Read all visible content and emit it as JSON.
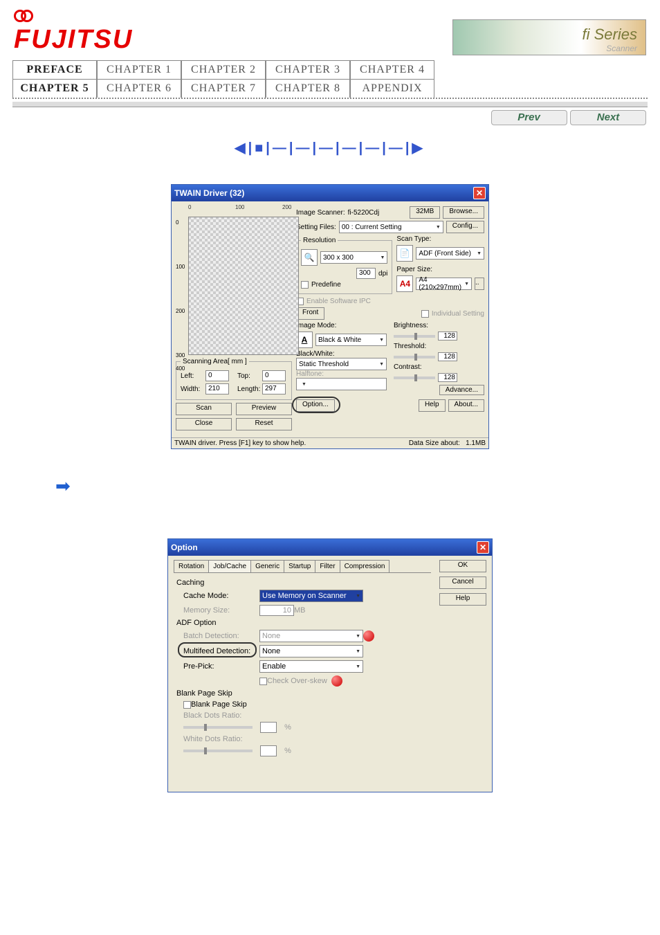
{
  "logo": "FUJITSU",
  "fiseries": "fi Series",
  "fiseries_sub": "Scanner",
  "nav": {
    "tabs": [
      "PREFACE",
      "CHAPTER 1",
      "CHAPTER 2",
      "CHAPTER 3",
      "CHAPTER 4",
      "CHAPTER 5",
      "CHAPTER 6",
      "CHAPTER 7",
      "CHAPTER 8",
      "APPENDIX"
    ]
  },
  "prev": "Prev",
  "next": "Next",
  "twain": {
    "title": "TWAIN Driver (32)",
    "ruler_marks": [
      "0",
      "100",
      "200"
    ],
    "scanning_area_label": "Scanning Area[ mm ]",
    "left_label": "Left:",
    "left_value": "0",
    "top_label": "Top:",
    "top_value": "0",
    "width_label": "Width:",
    "width_value": "210",
    "length_label": "Length:",
    "length_value": "297",
    "scan_btn": "Scan",
    "preview_btn": "Preview",
    "close_btn": "Close",
    "reset_btn": "Reset",
    "image_scanner_label": "Image Scanner:",
    "image_scanner_value": "fi-5220Cdj",
    "mem": "32MB",
    "browse_btn": "Browse...",
    "setting_files_label": "Setting Files:",
    "setting_files_value": "00 : Current Setting",
    "config_btn": "Config...",
    "resolution_label": "Resolution",
    "resolution_value": "300 x 300",
    "custom_res_value": "300",
    "dpi": "dpi",
    "predefine_label": "Predefine",
    "enable_ipc": "Enable Software IPC",
    "front_tab": "Front",
    "individual_setting": "Individual Setting",
    "scan_type_label": "Scan Type:",
    "scan_type_value": "ADF (Front Side)",
    "paper_size_label": "Paper Size:",
    "paper_size_value": "A4 (210x297mm)",
    "image_mode_label": "Image Mode:",
    "image_mode_value": "Black & White",
    "blackwhite_label": "Black/White:",
    "blackwhite_value": "Static Threshold",
    "halftone_label": "Halftone:",
    "brightness_label": "Brightness:",
    "brightness_value": "128",
    "threshold_label": "Threshold:",
    "threshold_value": "128",
    "contrast_label": "Contrast:",
    "contrast_value": "128",
    "advance_btn": "Advance...",
    "option_btn": "Option...",
    "help_btn": "Help",
    "about_btn": "About...",
    "status_left": "TWAIN driver. Press [F1] key to show help.",
    "status_mid": "Data Size about:",
    "status_right": "1.1MB"
  },
  "option": {
    "title": "Option",
    "tabs": [
      "Rotation",
      "Job/Cache",
      "Generic",
      "Startup",
      "Filter",
      "Compression"
    ],
    "ok": "OK",
    "cancel": "Cancel",
    "help": "Help",
    "caching_label": "Caching",
    "cache_mode_label": "Cache Mode:",
    "cache_mode_value": "Use Memory on Scanner",
    "memory_size_label": "Memory Size:",
    "memory_size_value": "10",
    "memory_size_unit": "MB",
    "adf_option_label": "ADF Option",
    "batch_detection_label": "Batch Detection:",
    "batch_detection_value": "None",
    "multifeed_label": "Multifeed Detection:",
    "multifeed_value": "None",
    "prepick_label": "Pre-Pick:",
    "prepick_value": "Enable",
    "check_overskew": "Check Over-skew",
    "blank_page_skip_section": "Blank Page Skip",
    "blank_page_skip_chk": "Blank Page Skip",
    "black_dots_ratio": "Black Dots Ratio:",
    "white_dots_ratio": "White Dots Ratio:",
    "percent": "%"
  }
}
